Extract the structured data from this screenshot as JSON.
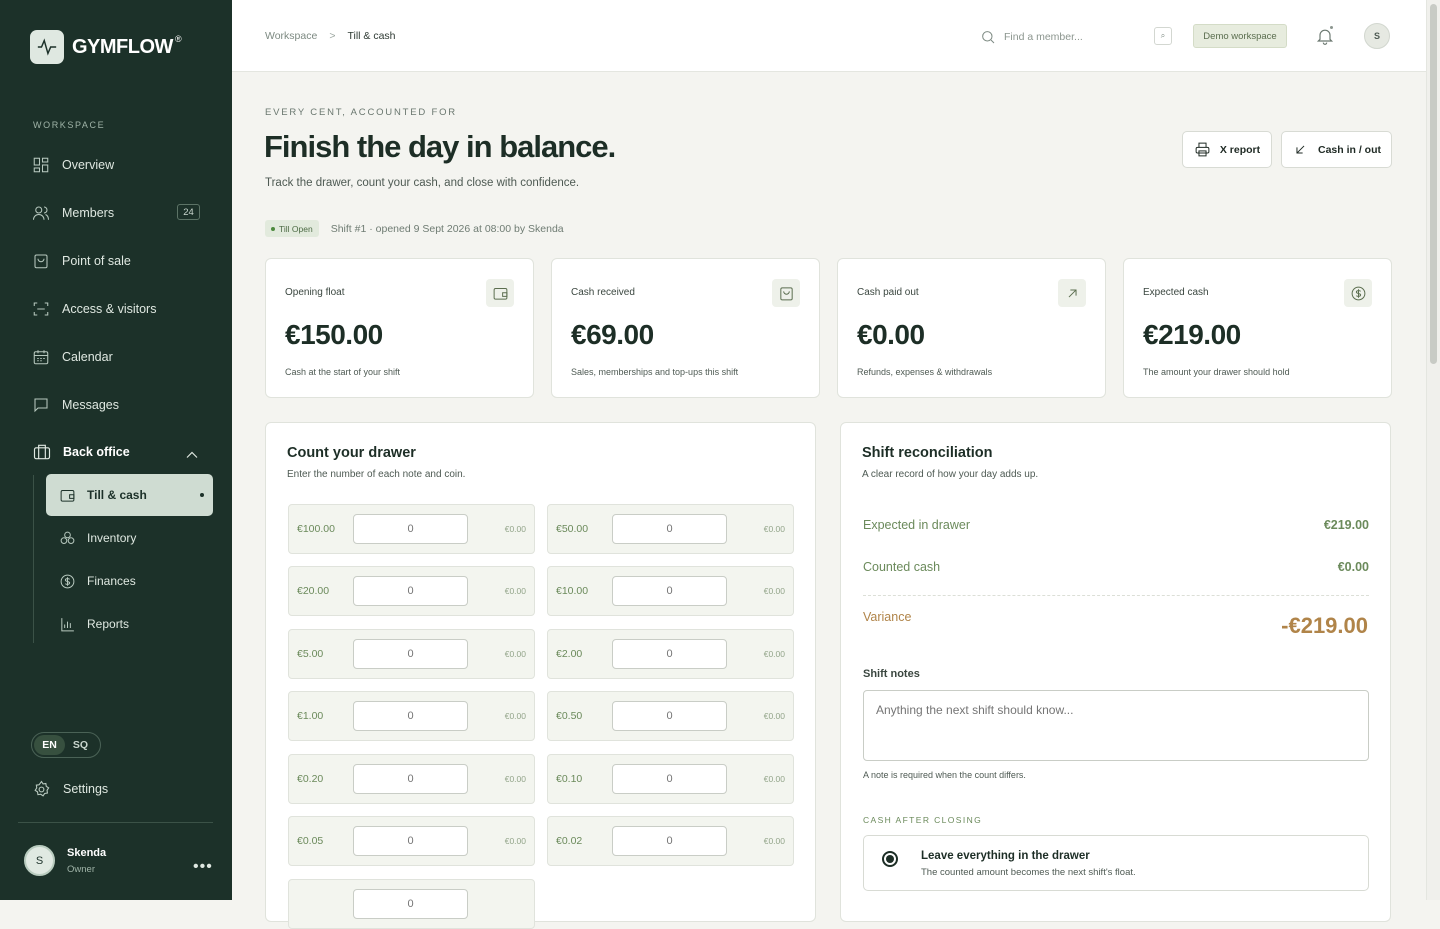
{
  "brand": {
    "name": "GYMFLOW",
    "reg": "®"
  },
  "sidebar": {
    "section_label": "WORKSPACE",
    "items": [
      {
        "label": "Overview",
        "icon": "grid-icon"
      },
      {
        "label": "Members",
        "icon": "users-icon",
        "badge": "24"
      },
      {
        "label": "Point of sale",
        "icon": "shopping-bag-icon"
      },
      {
        "label": "Access & visitors",
        "icon": "scan-icon"
      },
      {
        "label": "Calendar",
        "icon": "calendar-icon"
      },
      {
        "label": "Messages",
        "icon": "message-icon"
      }
    ],
    "group": {
      "label": "Back office",
      "expanded": true,
      "items": [
        {
          "label": "Till & cash",
          "active": true
        },
        {
          "label": "Inventory"
        },
        {
          "label": "Finances"
        },
        {
          "label": "Reports"
        }
      ]
    },
    "languages": [
      "EN",
      "SQ"
    ],
    "active_language": "EN",
    "settings_label": "Settings",
    "user": {
      "initial": "S",
      "name": "Skenda",
      "role": "Owner"
    }
  },
  "topbar": {
    "breadcrumb": [
      "Workspace",
      "Till & cash"
    ],
    "search_placeholder": "Find a member...",
    "search_shortcut": "⌕",
    "workspace_badge": "Demo workspace",
    "avatar_initial": "S"
  },
  "header": {
    "eyebrow": "EVERY CENT, ACCOUNTED FOR",
    "title": "Finish the day in balance.",
    "subtitle": "Track the drawer, count your cash, and close with confidence.",
    "x_report_label": "X report",
    "cash_in_out_label": "Cash in / out"
  },
  "shift": {
    "status": "Till Open",
    "description": "Shift #1 · opened 9 Sept 2026 at 08:00 by Skenda"
  },
  "kpis": [
    {
      "label": "Opening float",
      "value": "€150.00",
      "desc": "Cash at the start of your shift",
      "icon": "wallet-icon"
    },
    {
      "label": "Cash received",
      "value": "€69.00",
      "desc": "Sales, memberships and top-ups this shift",
      "icon": "shopping-bag-icon"
    },
    {
      "label": "Cash paid out",
      "value": "€0.00",
      "desc": "Refunds, expenses & withdrawals",
      "icon": "arrow-up-right-icon"
    },
    {
      "label": "Expected cash",
      "value": "€219.00",
      "desc": "The amount your drawer should hold",
      "icon": "dollar-circle-icon"
    }
  ],
  "drawer": {
    "title": "Count your drawer",
    "subtitle": "Enter the number of each note and coin.",
    "denominations": [
      {
        "label": "€100.00",
        "count": "",
        "placeholder": "0",
        "total": "€0.00"
      },
      {
        "label": "€50.00",
        "count": "",
        "placeholder": "0",
        "total": "€0.00"
      },
      {
        "label": "€20.00",
        "count": "",
        "placeholder": "0",
        "total": "€0.00"
      },
      {
        "label": "€10.00",
        "count": "",
        "placeholder": "0",
        "total": "€0.00"
      },
      {
        "label": "€5.00",
        "count": "",
        "placeholder": "0",
        "total": "€0.00"
      },
      {
        "label": "€2.00",
        "count": "",
        "placeholder": "0",
        "total": "€0.00"
      },
      {
        "label": "€1.00",
        "count": "",
        "placeholder": "0",
        "total": "€0.00"
      },
      {
        "label": "€0.50",
        "count": "",
        "placeholder": "0",
        "total": "€0.00"
      },
      {
        "label": "€0.20",
        "count": "",
        "placeholder": "0",
        "total": "€0.00"
      },
      {
        "label": "€0.10",
        "count": "",
        "placeholder": "0",
        "total": "€0.00"
      },
      {
        "label": "€0.05",
        "count": "",
        "placeholder": "0",
        "total": "€0.00"
      },
      {
        "label": "€0.02",
        "count": "",
        "placeholder": "0",
        "total": "€0.00"
      }
    ]
  },
  "reconciliation": {
    "title": "Shift reconciliation",
    "subtitle": "A clear record of how your day adds up.",
    "expected_label": "Expected in drawer",
    "expected_value": "€219.00",
    "counted_label": "Counted cash",
    "counted_value": "€0.00",
    "variance_label": "Variance",
    "variance_value": "-€219.00",
    "notes_label": "Shift notes",
    "notes_placeholder": "Anything the next shift should know...",
    "notes_hint": "A note is required when the count differs.",
    "after_label": "CASH AFTER CLOSING",
    "option_title": "Leave everything in the drawer",
    "option_sub": "The counted amount becomes the next shift's float."
  }
}
